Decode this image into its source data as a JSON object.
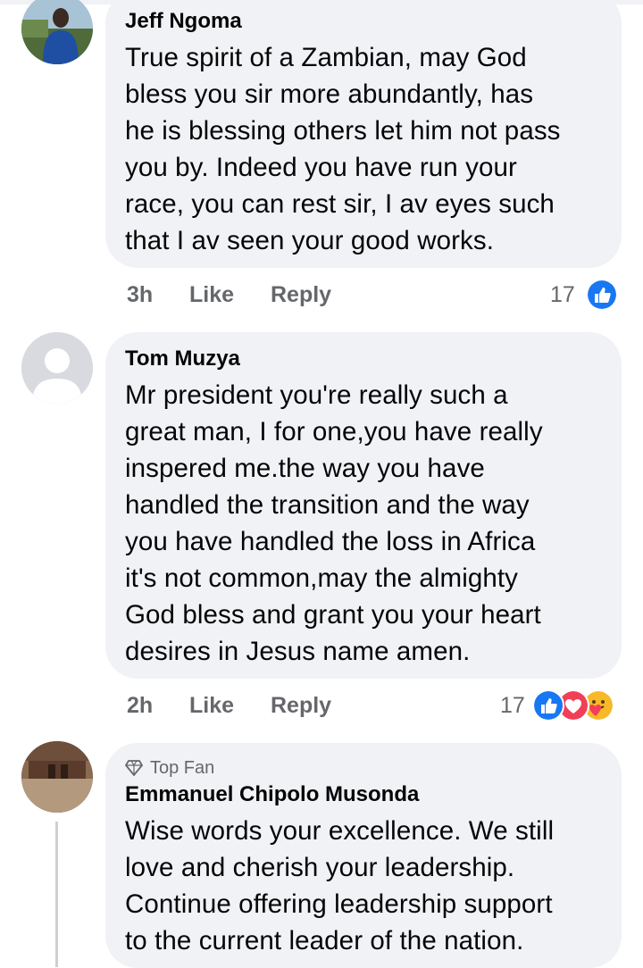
{
  "comments": [
    {
      "author": "Jeff Ngoma",
      "lines": [
        "True spirit of a Zambian, may God",
        "bless you sir more abundantly, has",
        "he is blessing others let him not pass",
        "you by. Indeed you have run your",
        "race, you can rest sir, I av eyes such",
        "that I av seen your good works."
      ],
      "time": "3h",
      "like_label": "Like",
      "reply_label": "Reply",
      "reaction_count": "17",
      "reactions": [
        "like"
      ]
    },
    {
      "author": "Tom Muzya",
      "lines": [
        "Mr president you're really such a",
        "great man, I for one,you have really",
        "inspered me.the way you have",
        "handled the transition and the way",
        "you have handled the loss in Africa",
        "it's not common,may the almighty",
        "God bless and grant you your heart",
        "desires in Jesus name amen."
      ],
      "time": "2h",
      "like_label": "Like",
      "reply_label": "Reply",
      "reaction_count": "17",
      "reactions": [
        "like",
        "love",
        "care"
      ]
    },
    {
      "badge": "Top Fan",
      "author": "Emmanuel Chipolo Musonda",
      "lines": [
        "Wise words your excellence. We still",
        "love and cherish your leadership.",
        "Continue offering leadership support",
        "to the current leader of the nation."
      ]
    }
  ],
  "colors": {
    "bubble": "#f0f2f5",
    "meta_text": "#65676b",
    "like_blue": "#1877f2",
    "love_red": "#f33e58",
    "care_yellow": "#f7b928"
  }
}
